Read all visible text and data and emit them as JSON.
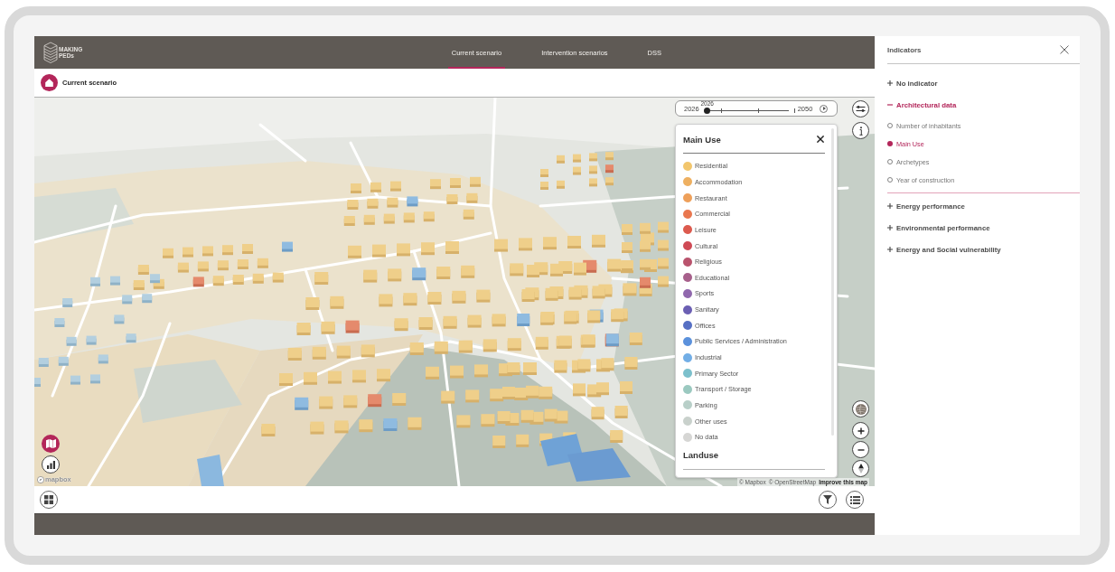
{
  "header": {
    "logo_lines": [
      "MAKING",
      "PEDs"
    ],
    "tabs": [
      {
        "label": "Current scenario",
        "selected": true
      },
      {
        "label": "Intervention scenarios",
        "selected": false
      },
      {
        "label": "DSS",
        "selected": false
      }
    ]
  },
  "scenario_bar": {
    "title": "Current scenario"
  },
  "map": {
    "timeline": {
      "start": "2026",
      "current": "2026",
      "end": "2050",
      "level": 0
    },
    "legend": {
      "title": "Main Use",
      "items": [
        {
          "label": "Residential",
          "color": "#f2c66d"
        },
        {
          "label": "Accommodation",
          "color": "#eeb061"
        },
        {
          "label": "Restaurant",
          "color": "#eea05a"
        },
        {
          "label": "Commercial",
          "color": "#e9774f"
        },
        {
          "label": "Leisure",
          "color": "#dc5a4e"
        },
        {
          "label": "Cultural",
          "color": "#cf4a55"
        },
        {
          "label": "Religious",
          "color": "#b9536d"
        },
        {
          "label": "Educational",
          "color": "#a7608b"
        },
        {
          "label": "Sports",
          "color": "#9068ad"
        },
        {
          "label": "Sanitary",
          "color": "#6b5fb3"
        },
        {
          "label": "Offices",
          "color": "#5670c4"
        },
        {
          "label": "Public Services / Administration",
          "color": "#5b91dc"
        },
        {
          "label": "Industrial",
          "color": "#72aee6"
        },
        {
          "label": "Primary Sector",
          "color": "#7cc0cc"
        },
        {
          "label": "Transport / Storage",
          "color": "#9bc9c0"
        },
        {
          "label": "Parking",
          "color": "#b8cfc8"
        },
        {
          "label": "Other uses",
          "color": "#c9d1cc"
        },
        {
          "label": "No data",
          "color": "#d6d6d4"
        }
      ],
      "next_section": "Landuse"
    },
    "logo": "mapbox",
    "attribution": [
      {
        "label": "© Mapbox",
        "kind": "copyright"
      },
      {
        "label": "© OpenStreetMap",
        "kind": "copyright"
      },
      {
        "label": "Improve this map",
        "kind": "feedback"
      }
    ]
  },
  "indicators": {
    "title": "Indicators",
    "groups": [
      {
        "label": "No indicator",
        "expanded": false
      },
      {
        "label": "Architectural data",
        "expanded": true,
        "options": [
          {
            "label": "Number of inhabitants",
            "selected": false
          },
          {
            "label": "Main Use",
            "selected": true
          },
          {
            "label": "Archetypes",
            "selected": false
          },
          {
            "label": "Year of construction",
            "selected": false
          }
        ]
      },
      {
        "label": "Energy performance",
        "expanded": false
      },
      {
        "label": "Environmental performance",
        "expanded": false
      },
      {
        "label": "Energy and Social vulnerability",
        "expanded": false
      }
    ]
  }
}
